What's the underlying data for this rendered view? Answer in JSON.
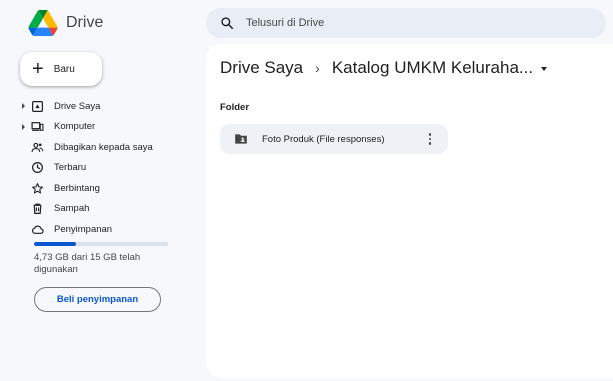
{
  "app": {
    "name": "Drive"
  },
  "search": {
    "placeholder": "Telusuri di Drive"
  },
  "new_button": {
    "label": "Baru"
  },
  "sidebar": {
    "items": [
      {
        "label": "Drive Saya",
        "icon": "my-drive-icon",
        "expandable": true
      },
      {
        "label": "Komputer",
        "icon": "computer-icon",
        "expandable": true
      },
      {
        "label": "Dibagikan kepada saya",
        "icon": "shared-people-icon",
        "expandable": false
      },
      {
        "label": "Terbaru",
        "icon": "clock-icon",
        "expandable": false
      },
      {
        "label": "Berbintang",
        "icon": "star-icon",
        "expandable": false
      },
      {
        "label": "Sampah",
        "icon": "trash-icon",
        "expandable": false
      },
      {
        "label": "Penyimpanan",
        "icon": "cloud-icon",
        "expandable": false
      }
    ]
  },
  "storage": {
    "used_fraction": 0.315,
    "text": "4,73 GB dari 15 GB telah digunakan",
    "buy_label": "Beli penyimpanan"
  },
  "breadcrumb": {
    "root": "Drive Saya",
    "separator": "›",
    "current": "Katalog UMKM Keluraha..."
  },
  "main": {
    "section_label": "Folder",
    "folders": [
      {
        "name": "Foto Produk (File responses)"
      }
    ]
  },
  "colors": {
    "background": "#f6f8fc",
    "accent": "#0b57d0",
    "search_bg": "#e9eef6",
    "folder_card_bg": "#eef1f6"
  }
}
